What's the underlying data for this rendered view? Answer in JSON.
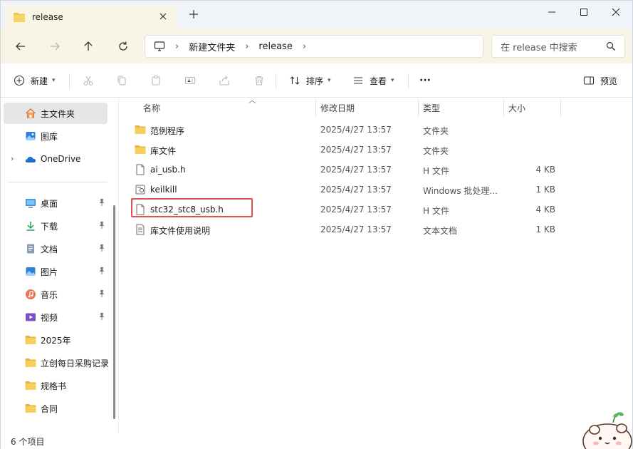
{
  "window": {
    "tab_title": "release",
    "controls": {
      "minimize": "minimize-icon",
      "maximize": "maximize-icon",
      "close": "close-icon"
    }
  },
  "nav": {
    "breadcrumb": [
      "新建文件夹",
      "release"
    ],
    "search_placeholder": "在 release 中搜索"
  },
  "toolbar": {
    "new_label": "新建",
    "sort_label": "排序",
    "view_label": "查看",
    "more_label": "···",
    "preview_label": "预览"
  },
  "sidebar": {
    "home": "主文件夹",
    "gallery": "图库",
    "onedrive": "OneDrive",
    "quick_access": [
      {
        "label": "桌面",
        "icon": "desktop-icon",
        "pinned": true
      },
      {
        "label": "下载",
        "icon": "download-icon",
        "pinned": true
      },
      {
        "label": "文档",
        "icon": "document-icon",
        "pinned": true
      },
      {
        "label": "图片",
        "icon": "picture-icon",
        "pinned": true
      },
      {
        "label": "音乐",
        "icon": "music-icon",
        "pinned": true
      },
      {
        "label": "视频",
        "icon": "video-icon",
        "pinned": true
      },
      {
        "label": "2025年",
        "icon": "folder-icon",
        "pinned": false
      },
      {
        "label": "立创每日采购记录",
        "icon": "folder-icon",
        "pinned": false
      },
      {
        "label": "规格书",
        "icon": "folder-icon",
        "pinned": false
      },
      {
        "label": "合同",
        "icon": "folder-icon",
        "pinned": false
      }
    ]
  },
  "columns": {
    "name": "名称",
    "date": "修改日期",
    "type": "类型",
    "size": "大小"
  },
  "files": [
    {
      "name": "范例程序",
      "date": "2025/4/27 13:57",
      "type": "文件夹",
      "size": "",
      "icon": "folder-icon"
    },
    {
      "name": "库文件",
      "date": "2025/4/27 13:57",
      "type": "文件夹",
      "size": "",
      "icon": "folder-icon"
    },
    {
      "name": "ai_usb.h",
      "date": "2025/4/27 13:57",
      "type": "H 文件",
      "size": "4 KB",
      "icon": "file-icon"
    },
    {
      "name": "keilkill",
      "date": "2025/4/27 13:57",
      "type": "Windows 批处理...",
      "size": "1 KB",
      "icon": "batch-file-icon"
    },
    {
      "name": "stc32_stc8_usb.h",
      "date": "2025/4/27 13:57",
      "type": "H 文件",
      "size": "4 KB",
      "icon": "file-icon"
    },
    {
      "name": "库文件使用说明",
      "date": "2025/4/27 13:57",
      "type": "文本文档",
      "size": "1 KB",
      "icon": "text-file-icon"
    }
  ],
  "status": {
    "item_count": "6 个项目"
  },
  "colors": {
    "accent": "#0067c0",
    "folder": "#f4c542",
    "highlight": "#e05050",
    "nav_bg": "#f8f4e6"
  }
}
